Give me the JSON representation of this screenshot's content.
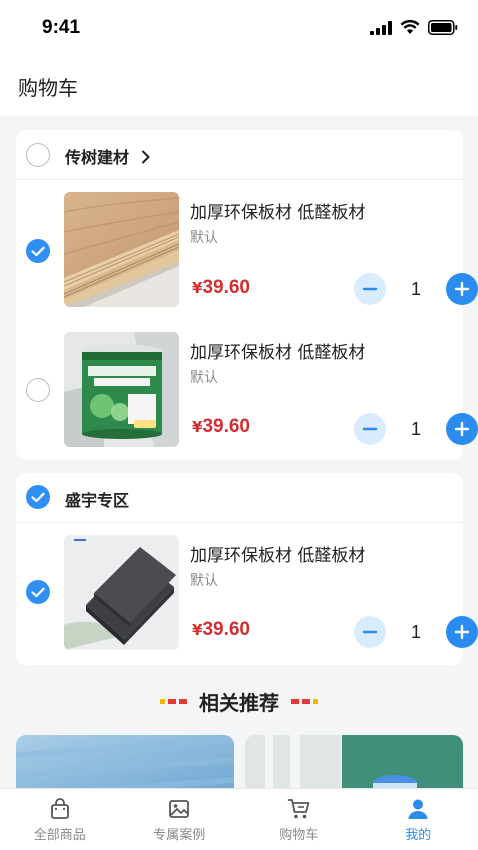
{
  "status_bar": {
    "time": "9:41"
  },
  "header": {
    "title": "购物车"
  },
  "stores": [
    {
      "name": "传树建材",
      "checked": false,
      "items": [
        {
          "title": "加厚环保板材 低醛板材",
          "spec": "默认",
          "currency": "¥",
          "price": "39.60",
          "qty": "1",
          "checked": true,
          "image": "wood-board"
        },
        {
          "title": "加厚环保板材 低醛板材",
          "spec": "默认",
          "currency": "¥",
          "price": "39.60",
          "qty": "1",
          "checked": false,
          "image": "paint-bucket"
        }
      ]
    },
    {
      "name": "盛宇专区",
      "checked": true,
      "items": [
        {
          "title": "加厚环保板材 低醛板材",
          "spec": "默认",
          "currency": "¥",
          "price": "39.60",
          "qty": "1",
          "checked": true,
          "image": "foam-panel"
        }
      ]
    }
  ],
  "recommend": {
    "title": "相关推荐"
  },
  "tabs": [
    {
      "label": "全部商品",
      "icon": "bag-icon",
      "active": false
    },
    {
      "label": "专属案例",
      "icon": "picture-icon",
      "active": false
    },
    {
      "label": "购物车",
      "icon": "cart-icon",
      "active": false
    },
    {
      "label": "我的",
      "icon": "user-icon",
      "active": true
    }
  ],
  "colors": {
    "accent": "#2b8cf0",
    "price": "#d32f2f",
    "dot_red": "#e53935",
    "dot_yellow": "#f5b400"
  }
}
